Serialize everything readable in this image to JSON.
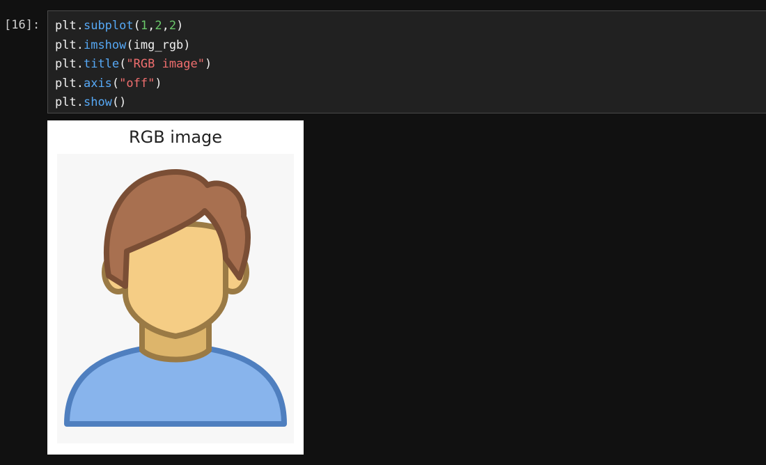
{
  "cell": {
    "prompt": "[16]:",
    "lines": [
      [
        {
          "t": "plt",
          "c": "var"
        },
        {
          "t": ".",
          "c": "punc"
        },
        {
          "t": "subplot",
          "c": "fn"
        },
        {
          "t": "(",
          "c": "punc"
        },
        {
          "t": "1",
          "c": "num"
        },
        {
          "t": ",",
          "c": "punc"
        },
        {
          "t": "2",
          "c": "num"
        },
        {
          "t": ",",
          "c": "punc"
        },
        {
          "t": "2",
          "c": "num"
        },
        {
          "t": ")",
          "c": "punc"
        }
      ],
      [
        {
          "t": "plt",
          "c": "var"
        },
        {
          "t": ".",
          "c": "punc"
        },
        {
          "t": "imshow",
          "c": "fn"
        },
        {
          "t": "(",
          "c": "punc"
        },
        {
          "t": "img_rgb",
          "c": "var"
        },
        {
          "t": ")",
          "c": "punc"
        }
      ],
      [
        {
          "t": "plt",
          "c": "var"
        },
        {
          "t": ".",
          "c": "punc"
        },
        {
          "t": "title",
          "c": "fn"
        },
        {
          "t": "(",
          "c": "punc"
        },
        {
          "t": "\"RGB image\"",
          "c": "str"
        },
        {
          "t": ")",
          "c": "punc"
        }
      ],
      [
        {
          "t": "plt",
          "c": "var"
        },
        {
          "t": ".",
          "c": "punc"
        },
        {
          "t": "axis",
          "c": "fn"
        },
        {
          "t": "(",
          "c": "punc"
        },
        {
          "t": "\"off\"",
          "c": "str"
        },
        {
          "t": ")",
          "c": "punc"
        }
      ],
      [
        {
          "t": "plt",
          "c": "var"
        },
        {
          "t": ".",
          "c": "punc"
        },
        {
          "t": "show",
          "c": "fn"
        },
        {
          "t": "()",
          "c": "punc"
        }
      ]
    ]
  },
  "output": {
    "title": "RGB image",
    "image_icon": "person-avatar-icon",
    "colors": {
      "hair": "#a87050",
      "hair_outline": "#7a4e35",
      "skin": "#f5cd85",
      "neck": "#ddb56b",
      "skin_outline": "#9a7a45",
      "shirt": "#88b4ec",
      "shirt_outline": "#4f7fbf",
      "background": "#f7f7f7"
    }
  }
}
